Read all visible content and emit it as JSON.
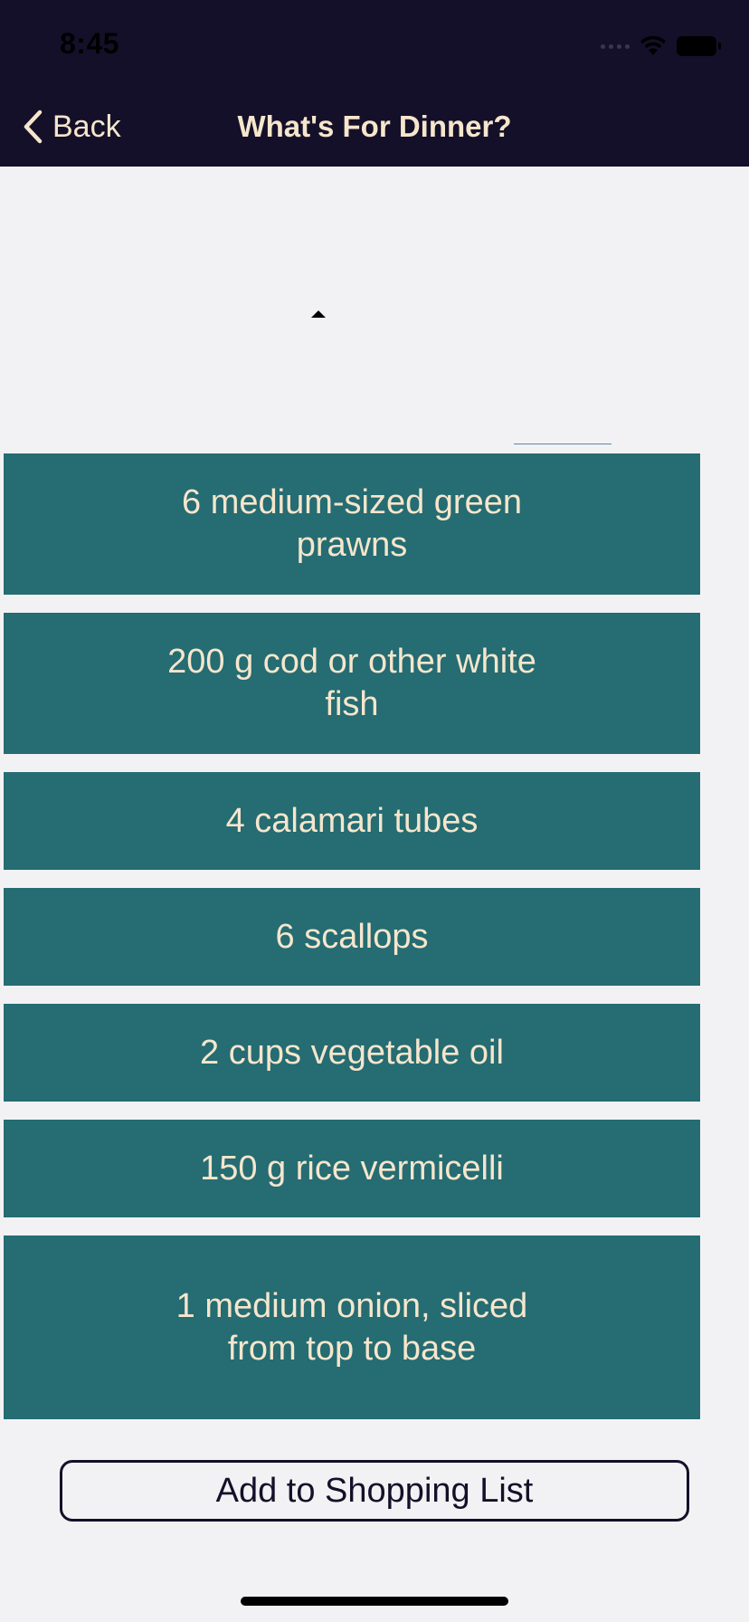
{
  "status_bar": {
    "time": "8:45"
  },
  "nav": {
    "back_label": "Back",
    "title": "What's For Dinner?"
  },
  "ingredients": [
    "6 medium-sized green prawns",
    "200 g cod or other white fish",
    "4 calamari tubes",
    "6 scallops",
    "2 cups vegetable oil",
    "150 g rice vermicelli",
    "1 medium onion, sliced from top to base"
  ],
  "actions": {
    "add_to_list_label": "Add to Shopping List"
  },
  "colors": {
    "nav_background": "#151029",
    "nav_text": "#f5e6cc",
    "tile_background": "#256c73",
    "tile_text": "#f5e6cc",
    "page_background": "#f2f2f4"
  },
  "icons": {
    "back": "chevron-left-icon",
    "wifi": "wifi-icon",
    "battery": "battery-icon",
    "signal": "cellular-signal-icon"
  }
}
